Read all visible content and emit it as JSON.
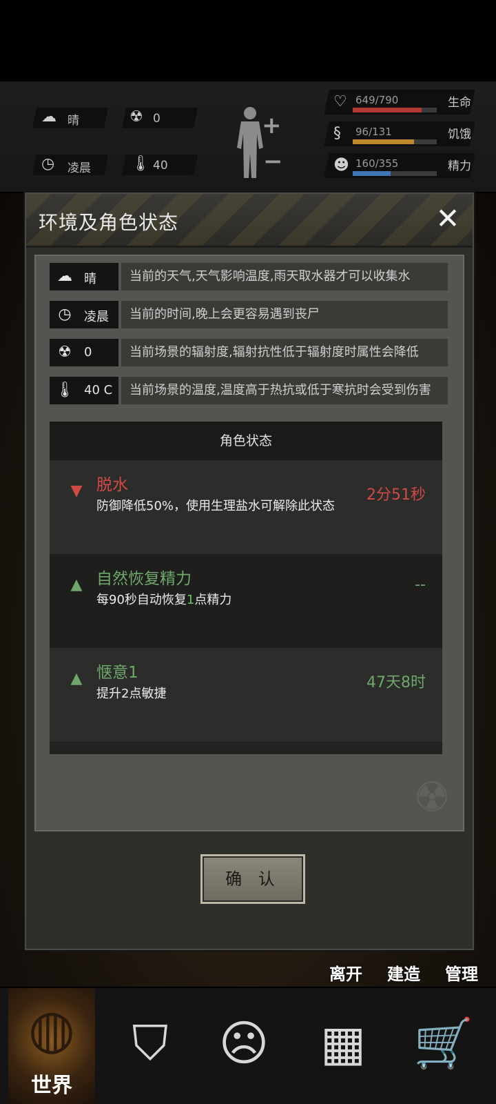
{
  "hud": {
    "weather": "晴",
    "radiation": "0",
    "time_of_day": "凌晨",
    "temperature": "40",
    "stats": [
      {
        "label": "生命",
        "value": "649/790",
        "fraction": 0.82,
        "color": "#b23a32"
      },
      {
        "label": "饥饿",
        "value": "96/131",
        "fraction": 0.73,
        "color": "#c08a2a"
      },
      {
        "label": "精力",
        "value": "160/355",
        "fraction": 0.45,
        "color": "#3f74b5"
      }
    ]
  },
  "modal": {
    "title": "环境及角色状态",
    "close_icon": "close-icon",
    "info_rows": [
      {
        "icon": "weather-icon",
        "key": "晴",
        "desc": "当前的天气,天气影响温度,雨天取水器才可以收集水"
      },
      {
        "icon": "clock-icon",
        "key": "凌晨",
        "desc": "当前的时间,晚上会更容易遇到丧尸"
      },
      {
        "icon": "radiation-icon",
        "key": "0",
        "desc": "当前场景的辐射度,辐射抗性低于辐射度时属性会降低"
      },
      {
        "icon": "thermometer-icon",
        "key": "40 C",
        "desc": "当前场景的温度,温度高于热抗或低于寒抗时会受到伤害"
      }
    ],
    "status_header": "角色状态",
    "statuses": [
      {
        "name": "脱水",
        "desc": "防御降低50%，使用生理盐水可解除此状态",
        "time": "2分51秒",
        "color": "#d24a45",
        "type": "debuff"
      },
      {
        "name": "自然恢复精力",
        "desc_parts": [
          "每90秒自动恢复",
          "1",
          "点精力"
        ],
        "time": "--",
        "color": "#6ea86a",
        "type": "buff"
      },
      {
        "name": "惬意1",
        "desc": "提升2点敏捷",
        "time": "47天8时",
        "color": "#6ea86a",
        "type": "buff"
      }
    ],
    "confirm_label": "确 认"
  },
  "actions": [
    "离开",
    "建造",
    "管理"
  ],
  "nav": [
    "世界",
    "",
    "",
    "",
    ""
  ]
}
